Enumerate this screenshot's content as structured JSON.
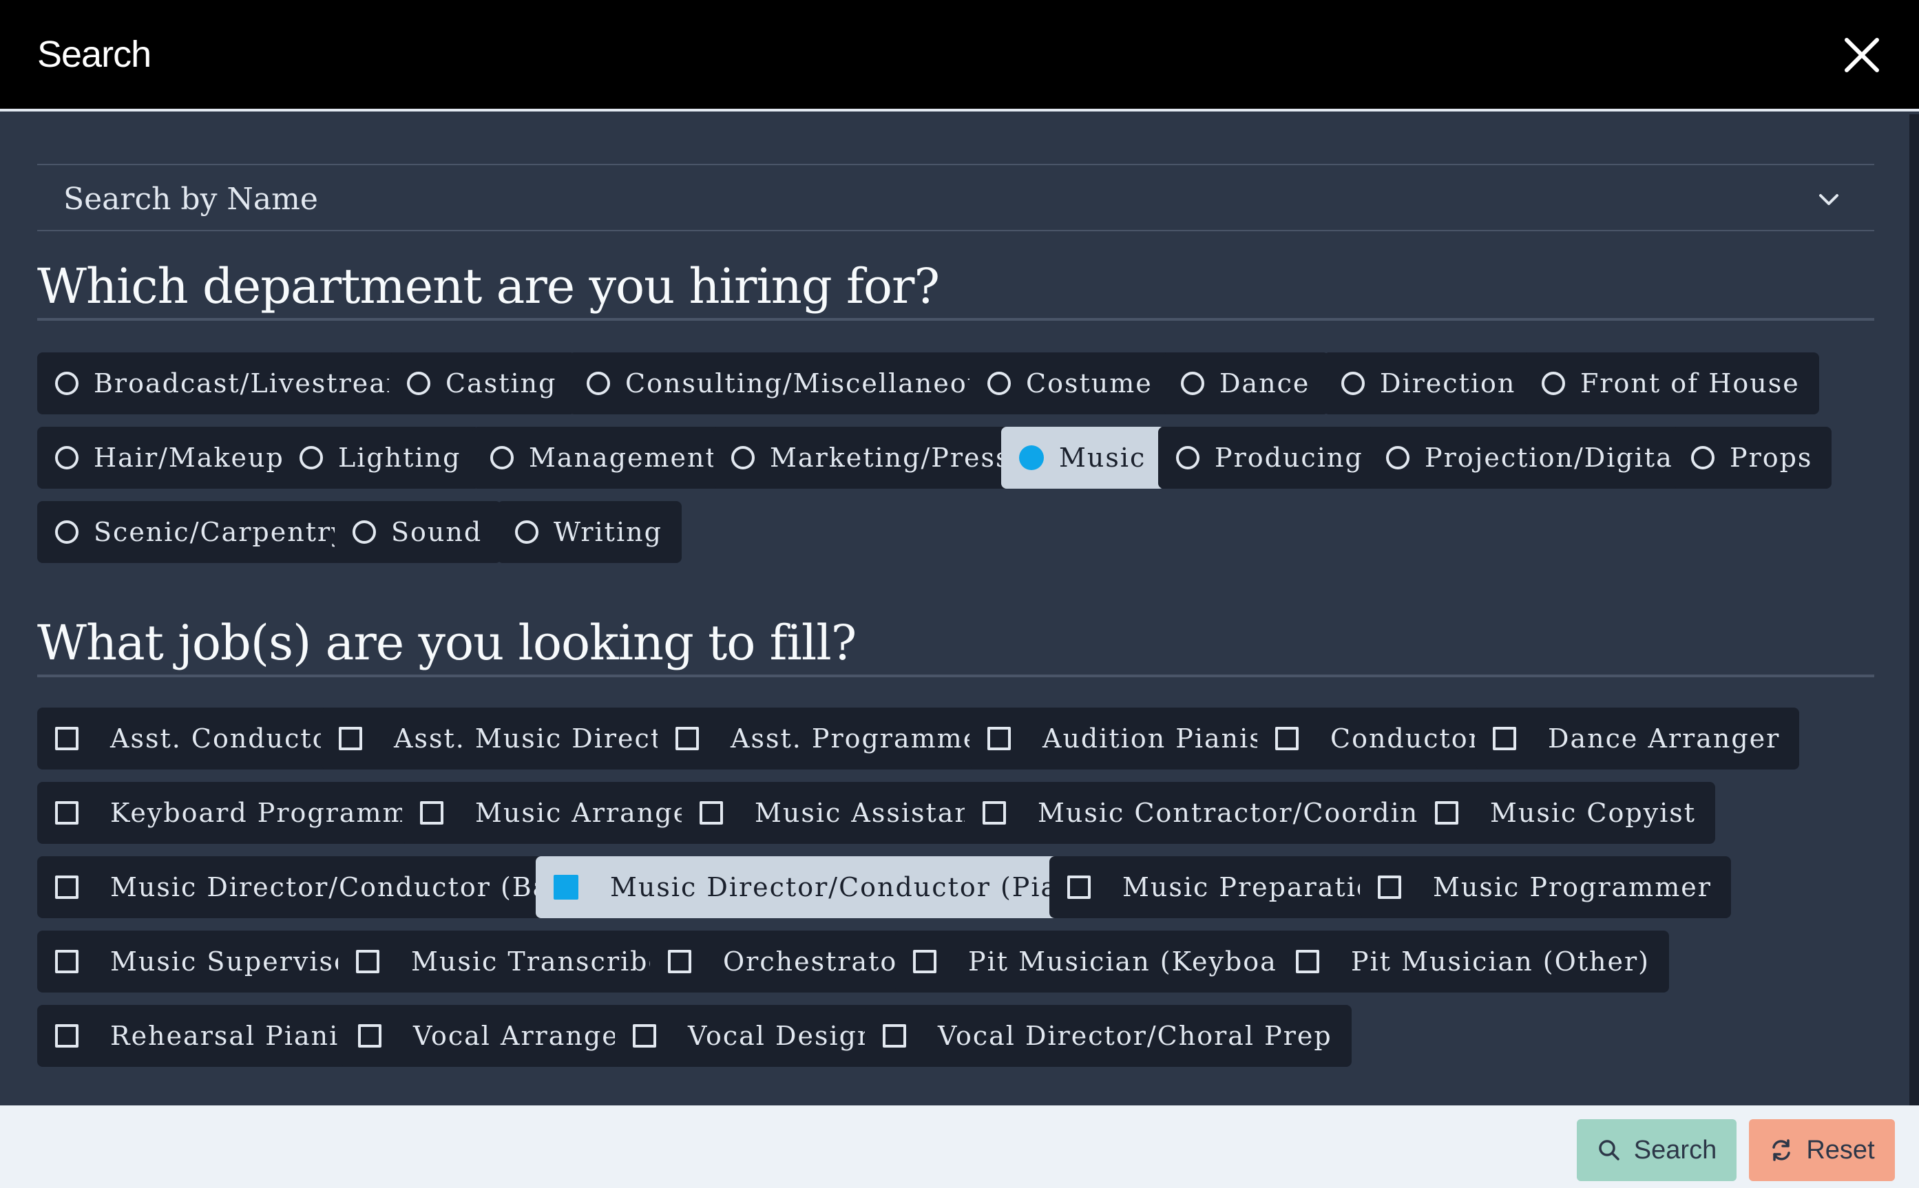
{
  "header": {
    "title": "Search"
  },
  "search_select": {
    "label": "Search by Name"
  },
  "departments": {
    "title": "Which department are you hiring for?",
    "options": [
      {
        "label": "Broadcast/Livestream",
        "selected": false
      },
      {
        "label": "Casting",
        "selected": false
      },
      {
        "label": "Consulting/Miscellaneous",
        "selected": false
      },
      {
        "label": "Costume",
        "selected": false
      },
      {
        "label": "Dance",
        "selected": false
      },
      {
        "label": "Direction",
        "selected": false
      },
      {
        "label": "Front of House",
        "selected": false
      },
      {
        "label": "Hair/Makeup",
        "selected": false
      },
      {
        "label": "Lighting",
        "selected": false
      },
      {
        "label": "Management",
        "selected": false
      },
      {
        "label": "Marketing/Press",
        "selected": false
      },
      {
        "label": "Music",
        "selected": true
      },
      {
        "label": "Producing",
        "selected": false
      },
      {
        "label": "Projection/Digital",
        "selected": false
      },
      {
        "label": "Props",
        "selected": false
      },
      {
        "label": "Scenic/Carpentry",
        "selected": false
      },
      {
        "label": "Sound",
        "selected": false
      },
      {
        "label": "Writing",
        "selected": false
      }
    ]
  },
  "jobs": {
    "title": "What job(s) are you looking to fill?",
    "options": [
      {
        "label": "Asst. Conductor",
        "checked": false
      },
      {
        "label": "Asst. Music Director",
        "checked": false
      },
      {
        "label": "Asst. Programmer",
        "checked": false
      },
      {
        "label": "Audition Pianist",
        "checked": false
      },
      {
        "label": "Conductor",
        "checked": false
      },
      {
        "label": "Dance Arranger",
        "checked": false
      },
      {
        "label": "Keyboard Programmer",
        "checked": false
      },
      {
        "label": "Music Arranger",
        "checked": false
      },
      {
        "label": "Music Assistant",
        "checked": false
      },
      {
        "label": "Music Contractor/Coordinator",
        "checked": false
      },
      {
        "label": "Music Copyist",
        "checked": false
      },
      {
        "label": "Music Director/Conductor (Baton)",
        "checked": false
      },
      {
        "label": "Music Director/Conductor (Pianist)",
        "checked": true
      },
      {
        "label": "Music Preparation",
        "checked": false
      },
      {
        "label": "Music Programmer",
        "checked": false
      },
      {
        "label": "Music Supervisor",
        "checked": false
      },
      {
        "label": "Music Transcriber",
        "checked": false
      },
      {
        "label": "Orchestrator",
        "checked": false
      },
      {
        "label": "Pit Musician (Keyboard)",
        "checked": false
      },
      {
        "label": "Pit Musician (Other)",
        "checked": false
      },
      {
        "label": "Rehearsal Pianist",
        "checked": false
      },
      {
        "label": "Vocal Arranger",
        "checked": false
      },
      {
        "label": "Vocal Design",
        "checked": false
      },
      {
        "label": "Vocal Director/Choral Prep",
        "checked": false
      }
    ]
  },
  "footer": {
    "search_label": "Search",
    "reset_label": "Reset"
  },
  "colors": {
    "accent": "#0ea5e9",
    "search_button": "#9fd3c4",
    "reset_button": "#f4a58a"
  }
}
